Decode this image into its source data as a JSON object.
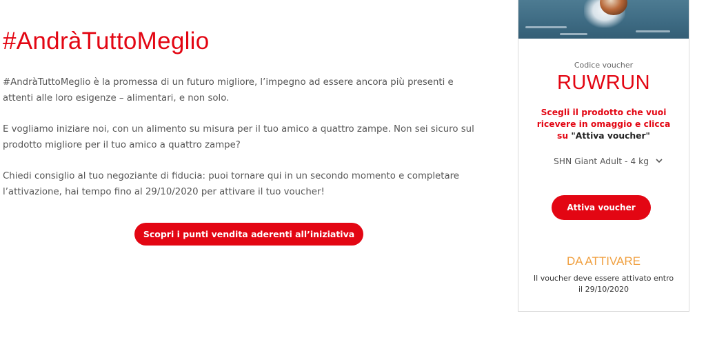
{
  "main": {
    "title": "#AndràTuttoMeglio",
    "paragraphs": [
      "#AndràTuttoMeglio è la promessa di un futuro migliore, l’impegno ad essere ancora più presenti e attenti alle loro esigenze – alimentari, e non solo.",
      "E vogliamo iniziare noi, con un alimento su misura per il tuo amico a quattro zampe. Non sei sicuro sul prodotto migliore per il tuo amico a quattro zampe?",
      "Chiedi consiglio al tuo negoziante di fiducia: puoi tornare qui in un secondo momento e completare l’attivazione, hai tempo fino al 29/10/2020 per attivare il tuo voucher!"
    ],
    "cta_label": "Scopri i punti vendita aderenti all’iniziativa"
  },
  "voucher": {
    "code_label": "Codice voucher",
    "code": "RUWRUN",
    "instruction": "Scegli il prodotto che vuoi ricevere in omaggio e clicca su",
    "instruction_quoted": "\"Attiva voucher\"",
    "selected_product": "SHN Giant Adult - 4 kg",
    "activate_label": "Attiva voucher",
    "status": "DA ATTIVARE",
    "status_note": "Il voucher deve essere attivato entro il 29/10/2020"
  },
  "colors": {
    "accent": "#e30613",
    "status": "#f0a040"
  },
  "icons": {
    "select": "chevron-down-icon"
  }
}
